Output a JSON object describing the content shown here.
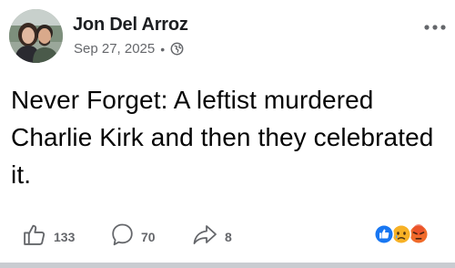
{
  "post": {
    "author": "Jon Del Arroz",
    "date": "Sep 27, 2025",
    "separator": "•",
    "visibility_icon": "globe-icon",
    "more_icon": "more-horizontal-icon",
    "text": "Never Forget: A leftist murdered Charlie Kirk and then they celebrated it."
  },
  "actions": {
    "like_count": "133",
    "comment_count": "70",
    "share_count": "8"
  },
  "reactions": [
    "like-reaction-icon",
    "sad-reaction-icon",
    "angry-reaction-icon"
  ],
  "colors": {
    "text": "#050505",
    "muted": "#65676b",
    "like_blue": "#1877f2",
    "sad_yellow": "#f7b125",
    "angry_red": "#e9710f"
  }
}
